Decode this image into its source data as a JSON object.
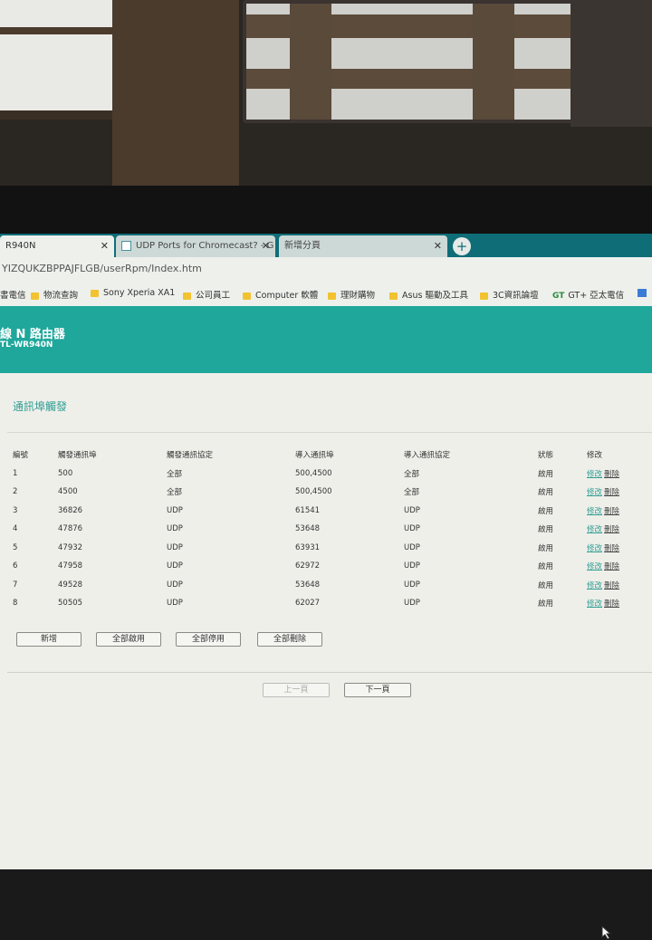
{
  "browser": {
    "tabs": [
      {
        "label": "R940N",
        "active": true
      },
      {
        "label": "UDP Ports for Chromecast? - G",
        "active": false
      },
      {
        "label": "新增分頁",
        "active": false
      }
    ],
    "address": "YIZQUKZBPPAJFLGB/userRpm/Index.htm",
    "bookmarks": [
      {
        "label": "書電信",
        "icon": "page-icon"
      },
      {
        "label": "物流查詢",
        "icon": "folder-icon"
      },
      {
        "label": "Sony Xperia XA1",
        "icon": "folder-icon"
      },
      {
        "label": "公司員工",
        "icon": "folder-icon"
      },
      {
        "label": "Computer 軟體",
        "icon": "folder-icon"
      },
      {
        "label": "理財購物",
        "icon": "folder-icon"
      },
      {
        "label": "Asus 驅動及工具",
        "icon": "folder-icon"
      },
      {
        "label": "3C資訊論壇",
        "icon": "folder-icon"
      },
      {
        "label": "GT+ 亞太電信",
        "icon": "gt-logo-icon",
        "logo_text": "GT"
      }
    ]
  },
  "router": {
    "title": "線 N 路由器",
    "model": "TL-WR940N",
    "section_title": "通訊埠觸發",
    "columns": [
      "編號",
      "觸發通訊埠",
      "觸發通訊協定",
      "導入通訊埠",
      "導入通訊協定",
      "狀態",
      "修改"
    ],
    "rows": [
      {
        "id": "1",
        "trigger_port": "500",
        "trigger_protocol": "全部",
        "incoming_ports": "500,4500",
        "incoming_protocol": "全部",
        "status": "啟用",
        "edit": "修改",
        "delete": "刪除"
      },
      {
        "id": "2",
        "trigger_port": "4500",
        "trigger_protocol": "全部",
        "incoming_ports": "500,4500",
        "incoming_protocol": "全部",
        "status": "啟用",
        "edit": "修改",
        "delete": "刪除"
      },
      {
        "id": "3",
        "trigger_port": "36826",
        "trigger_protocol": "UDP",
        "incoming_ports": "61541",
        "incoming_protocol": "UDP",
        "status": "啟用",
        "edit": "修改",
        "delete": "刪除"
      },
      {
        "id": "4",
        "trigger_port": "47876",
        "trigger_protocol": "UDP",
        "incoming_ports": "53648",
        "incoming_protocol": "UDP",
        "status": "啟用",
        "edit": "修改",
        "delete": "刪除"
      },
      {
        "id": "5",
        "trigger_port": "47932",
        "trigger_protocol": "UDP",
        "incoming_ports": "63931",
        "incoming_protocol": "UDP",
        "status": "啟用",
        "edit": "修改",
        "delete": "刪除"
      },
      {
        "id": "6",
        "trigger_port": "47958",
        "trigger_protocol": "UDP",
        "incoming_ports": "62972",
        "incoming_protocol": "UDP",
        "status": "啟用",
        "edit": "修改",
        "delete": "刪除"
      },
      {
        "id": "7",
        "trigger_port": "49528",
        "trigger_protocol": "UDP",
        "incoming_ports": "53648",
        "incoming_protocol": "UDP",
        "status": "啟用",
        "edit": "修改",
        "delete": "刪除"
      },
      {
        "id": "8",
        "trigger_port": "50505",
        "trigger_protocol": "UDP",
        "incoming_ports": "62027",
        "incoming_protocol": "UDP",
        "status": "啟用",
        "edit": "修改",
        "delete": "刪除"
      }
    ],
    "buttons": {
      "add": "新增",
      "enable_all": "全部啟用",
      "disable_all": "全部停用",
      "delete_all": "全部刪除"
    },
    "pager": {
      "prev": "上一頁",
      "next": "下一頁"
    }
  },
  "colors": {
    "brand": "#1fa79b",
    "tabbar": "#0f6d78",
    "link": "#2f9e93"
  }
}
